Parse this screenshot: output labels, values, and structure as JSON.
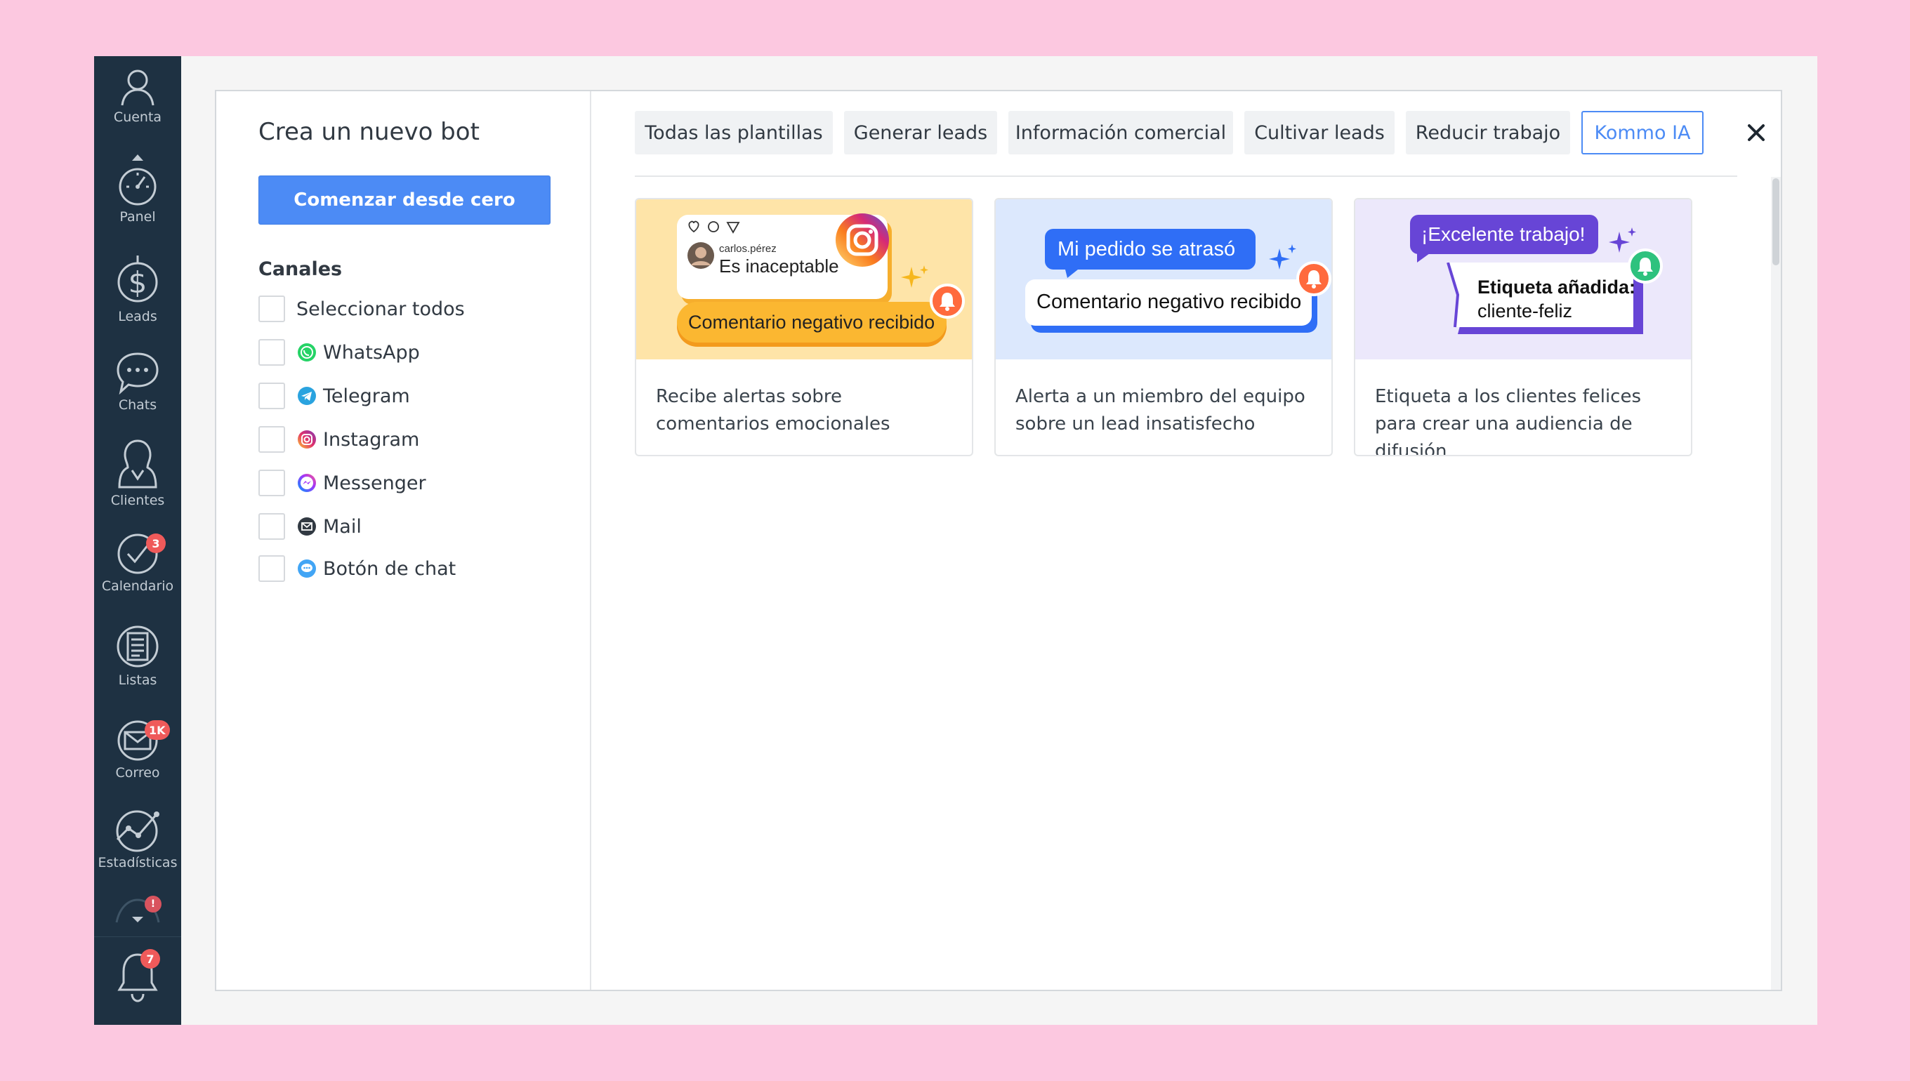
{
  "sidebar": {
    "items": [
      {
        "label": "Cuenta",
        "icon": "account-icon"
      },
      {
        "label": "Panel",
        "icon": "dashboard-icon"
      },
      {
        "label": "Leads",
        "icon": "leads-icon"
      },
      {
        "label": "Chats",
        "icon": "chats-icon"
      },
      {
        "label": "Clientes",
        "icon": "clients-icon"
      },
      {
        "label": "Calendario",
        "icon": "calendar-icon",
        "badge": "3"
      },
      {
        "label": "Listas",
        "icon": "lists-icon"
      },
      {
        "label": "Correo",
        "icon": "mail-icon",
        "badge": "1K"
      },
      {
        "label": "Estadísticas",
        "icon": "stats-icon"
      }
    ],
    "more_badge": "!",
    "notifications_badge": "7"
  },
  "modal": {
    "title": "Crea un nuevo bot",
    "start_button": "Comenzar desde cero",
    "channels_heading": "Canales",
    "channels": [
      {
        "label": "Seleccionar todos",
        "icon": null
      },
      {
        "label": "WhatsApp",
        "icon": "whatsapp-icon",
        "color": "#25d366"
      },
      {
        "label": "Telegram",
        "icon": "telegram-icon",
        "color": "#2aa3df"
      },
      {
        "label": "Instagram",
        "icon": "instagram-icon",
        "color": "#d6249f"
      },
      {
        "label": "Messenger",
        "icon": "messenger-icon",
        "color": "#a334fa"
      },
      {
        "label": "Mail",
        "icon": "mail-icon",
        "color": "#313942"
      },
      {
        "label": "Botón de chat",
        "icon": "chat-button-icon",
        "color": "#42a5f5"
      }
    ]
  },
  "tabs": [
    {
      "label": "Todas las plantillas",
      "active": false
    },
    {
      "label": "Generar leads",
      "active": false
    },
    {
      "label": "Información comercial",
      "active": false
    },
    {
      "label": "Cultivar leads",
      "active": false
    },
    {
      "label": "Reducir trabajo",
      "active": false
    },
    {
      "label": "Kommo IA",
      "active": true
    }
  ],
  "cards": [
    {
      "art": {
        "username": "carlos.pérez",
        "message": "Es inaceptable",
        "alert": "Comentario negativo recibido"
      },
      "description": "Recibe alertas sobre comentarios emocionales"
    },
    {
      "art": {
        "message": "Mi pedido se atrasó",
        "alert": "Comentario negativo recibido"
      },
      "description": "Alerta a un miembro del equipo sobre un lead insatisfecho"
    },
    {
      "art": {
        "message": "¡Excelente trabajo!",
        "tag_title": "Etiqueta añadida:",
        "tag_value": "cliente-feliz"
      },
      "description": "Etiqueta a los clientes felices para crear una audiencia de difusión"
    }
  ],
  "colors": {
    "accent": "#4c8bf5",
    "sidebar_bg": "#1e3142",
    "page_bg": "#fcc8e0",
    "badge": "#ef5a5a"
  }
}
